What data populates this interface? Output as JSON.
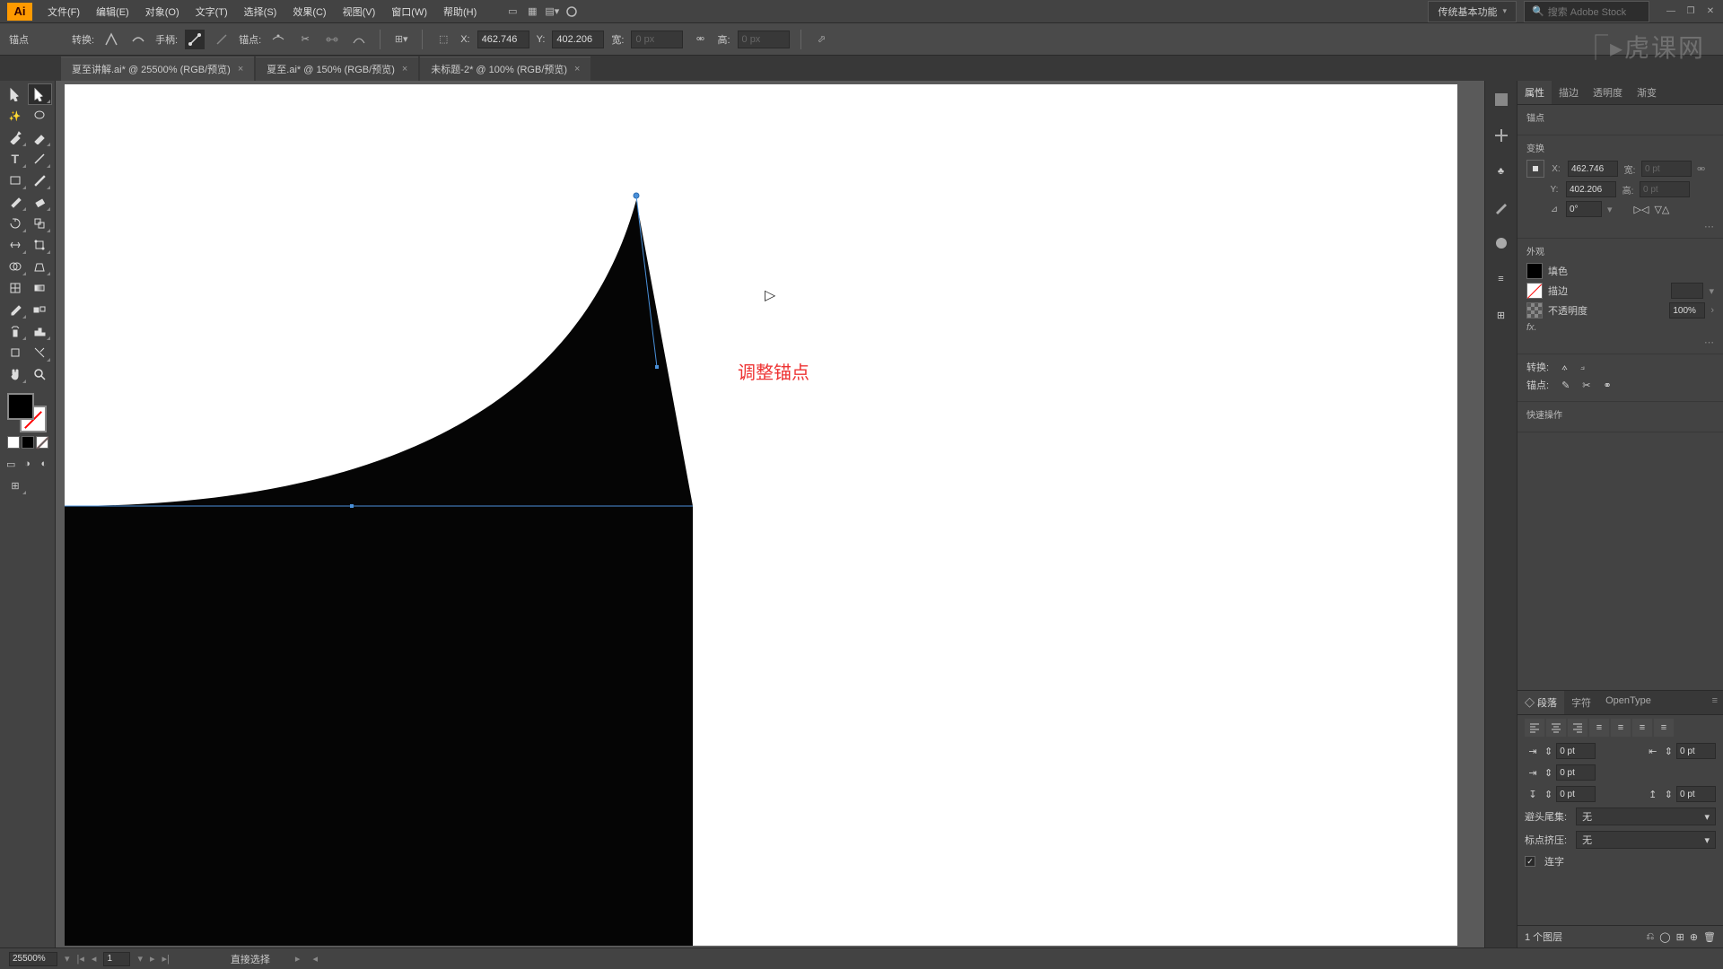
{
  "menubar": {
    "items": [
      "文件(F)",
      "编辑(E)",
      "对象(O)",
      "文字(T)",
      "选择(S)",
      "效果(C)",
      "视图(V)",
      "窗口(W)",
      "帮助(H)"
    ],
    "workspace": "传统基本功能",
    "search_placeholder": "搜索 Adobe Stock"
  },
  "controlbar": {
    "anchor_label": "锚点",
    "convert_label": "转换:",
    "handle_label": "手柄:",
    "anchor_pt_label": "锚点:",
    "x_label": "X:",
    "y_label": "Y:",
    "x_val": "462.746",
    "y_val": "402.206",
    "w_label": "宽:",
    "h_label": "高:",
    "w_val": "0 px",
    "h_val": "0 px"
  },
  "tabs": [
    {
      "label": "夏至讲解.ai* @ 25500% (RGB/预览)",
      "active": true
    },
    {
      "label": "夏至.ai* @ 150% (RGB/预览)",
      "active": false
    },
    {
      "label": "未标题-2* @ 100% (RGB/预览)",
      "active": false
    }
  ],
  "annotation": "调整锚点",
  "props": {
    "tabs": [
      "属性",
      "描边",
      "透明度",
      "渐变"
    ],
    "sec_anchor": "锚点",
    "sec_transform": "变换",
    "x": "462.746",
    "y": "402.206",
    "w": "0 pt",
    "h": "0 pt",
    "angle": "0°",
    "sec_appearance": "外观",
    "fill_label": "填色",
    "stroke_label": "描边",
    "opacity_label": "不透明度",
    "opacity_val": "100%",
    "convert_label": "转换:",
    "anchor_edit_label": "锚点:",
    "quick_label": "快速操作"
  },
  "para": {
    "tabs": [
      "◇ 段落",
      "字符",
      "OpenType"
    ],
    "indent_vals": [
      "0 pt",
      "0 pt",
      "0 pt",
      "0 pt",
      "0 pt"
    ],
    "bihua_label": "避头尾集:",
    "bihua_val": "无",
    "biaodian_label": "标点挤压:",
    "biaodian_val": "无",
    "lianzhi": "连字"
  },
  "layer": {
    "count": "1 个图层"
  },
  "status": {
    "zoom": "25500%",
    "artboard": "1",
    "tool": "直接选择"
  },
  "watermark": "⎾▸虎课网"
}
